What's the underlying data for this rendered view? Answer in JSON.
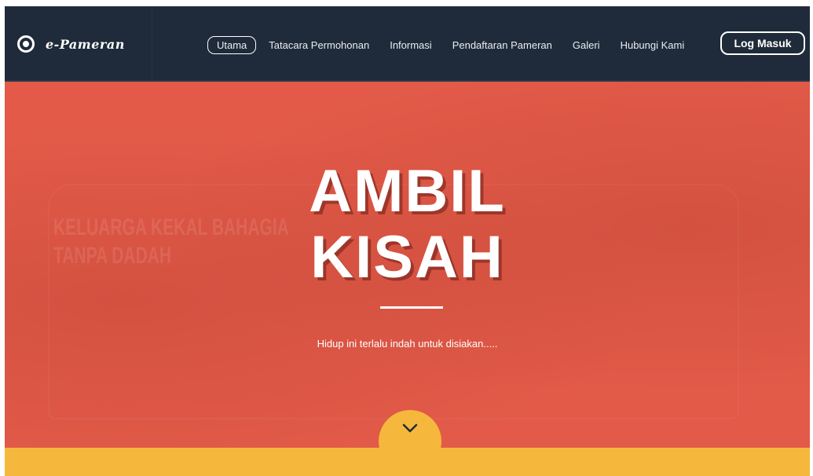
{
  "brand": {
    "name": "e-Pameran",
    "icon": "ring-logo-icon"
  },
  "nav": {
    "items": [
      {
        "label": "Utama",
        "active": true
      },
      {
        "label": "Tatacara Permohonan",
        "active": false
      },
      {
        "label": "Informasi",
        "active": false
      },
      {
        "label": "Pendaftaran Pameran",
        "active": false
      },
      {
        "label": "Galeri",
        "active": false
      },
      {
        "label": "Hubungi Kami",
        "active": false
      }
    ],
    "login_label": "Log Masuk"
  },
  "hero": {
    "title_line1": "AMBIL",
    "title_line2": "KISAH",
    "subtitle": "Hidup ini terlalu indah untuk disiakan.....",
    "background_text_line1": "KELUARGA KEKAL BAHAGIA",
    "background_text_line2": "TANPA DADAH",
    "scroll_icon": "chevron-down-icon"
  },
  "colors": {
    "navbar": "#1f2b3a",
    "hero": "#e35a48",
    "accent": "#f5b83c",
    "text": "#ffffff"
  }
}
